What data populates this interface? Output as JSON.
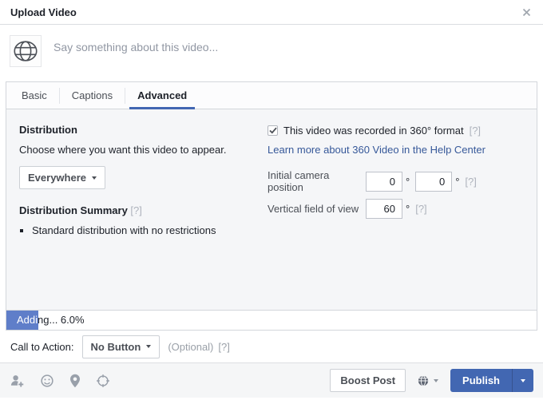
{
  "dialog": {
    "title": "Upload Video"
  },
  "composer": {
    "placeholder": "Say something about this video..."
  },
  "tabs": {
    "basic": "Basic",
    "captions": "Captions",
    "advanced": "Advanced",
    "active": "Advanced"
  },
  "distribution": {
    "heading": "Distribution",
    "description": "Choose where you want this video to appear.",
    "dropdown_label": "Everywhere",
    "summary_heading": "Distribution Summary",
    "summary_help": "[?]",
    "summary_item": "Standard distribution with no restrictions"
  },
  "video360": {
    "checkbox_label": "This video was recorded in 360° format",
    "checkbox_help": "[?]",
    "checkbox_checked": true,
    "learn_more_link": "Learn more about 360 Video in the Help Center",
    "initial_camera_label": "Initial camera position",
    "initial_camera_value_1": "0",
    "initial_camera_value_2": "0",
    "initial_camera_help": "[?]",
    "fov_label": "Vertical field of view",
    "fov_value": "60",
    "fov_help": "[?]",
    "degree_symbol": "°"
  },
  "progress": {
    "label": "Adding... 6.0%",
    "percent": 6
  },
  "cta": {
    "label": "Call to Action:",
    "button_label": "No Button",
    "optional_text": "(Optional)",
    "help": "[?]"
  },
  "footer": {
    "boost_button": "Boost Post",
    "publish_button": "Publish"
  },
  "colors": {
    "accent_blue": "#4267b2",
    "progress_fill": "#5f7ec9",
    "link_blue": "#365899",
    "border_gray": "#d3d6db"
  }
}
